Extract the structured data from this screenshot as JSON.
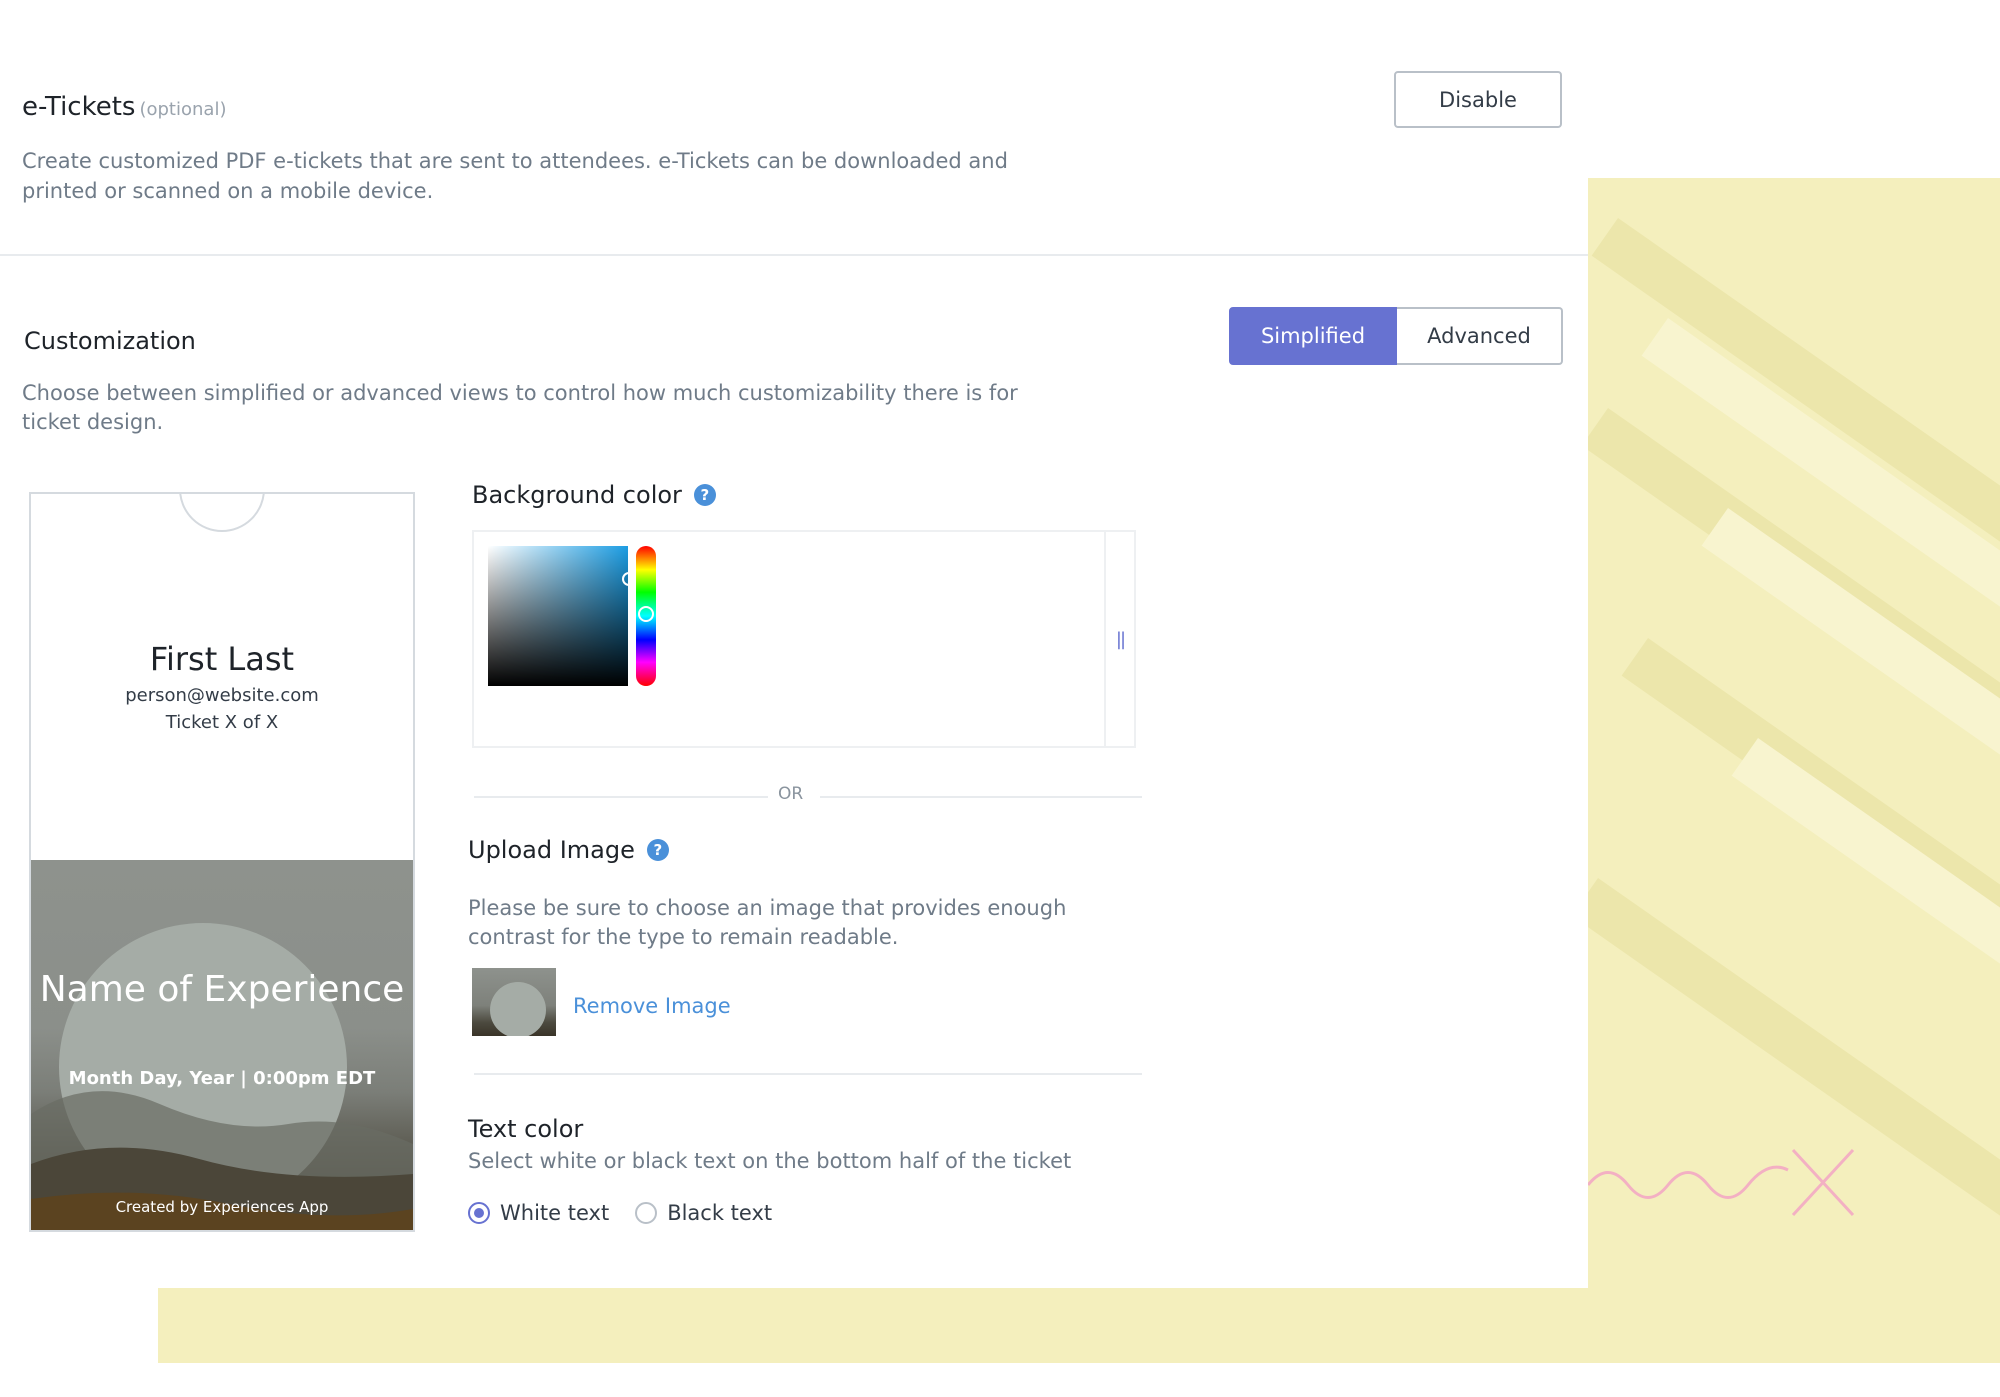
{
  "etickets": {
    "title": "e-Tickets",
    "optional_label": "(optional)",
    "description": "Create customized PDF e-tickets that are sent to attendees. e-Tickets can be downloaded and printed or scanned on a mobile device.",
    "disable_button": "Disable"
  },
  "customization": {
    "title": "Customization",
    "description": "Choose between simplified or advanced views to control how much customizability there is for ticket design.",
    "modes": [
      "Simplified",
      "Advanced"
    ],
    "active_mode": "Simplified"
  },
  "ticket_preview": {
    "name": "First Last",
    "email": "person@website.com",
    "ticket_number": "Ticket X of X",
    "experience_name": "Name of Experience",
    "date": "Month Day, Year | 0:00pm EDT",
    "credit": "Created by Experiences App"
  },
  "background_color": {
    "label": "Background color",
    "help_icon": "question-mark",
    "or_label": "OR"
  },
  "upload_image": {
    "label": "Upload Image",
    "help_icon": "question-mark",
    "description": "Please be sure to choose an image that provides enough contrast for the type to remain readable.",
    "remove_link": "Remove Image"
  },
  "text_color": {
    "label": "Text color",
    "description": "Select white or black text on the bottom half of the ticket",
    "options": [
      "White text",
      "Black text"
    ],
    "selected": "White text"
  },
  "colors": {
    "accent": "#6772d1",
    "link": "#4a90d9",
    "background_deco": "#f4efbd"
  }
}
